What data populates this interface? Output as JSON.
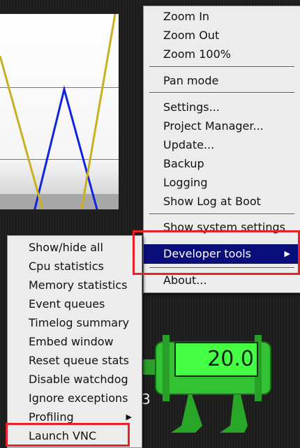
{
  "main_menu": {
    "items": [
      {
        "label": "Zoom In"
      },
      {
        "label": "Zoom Out"
      },
      {
        "label": "Zoom 100%"
      },
      {
        "label": "Pan mode"
      },
      {
        "label": "Settings..."
      },
      {
        "label": "Project Manager..."
      },
      {
        "label": "Update..."
      },
      {
        "label": "Backup"
      },
      {
        "label": "Logging"
      },
      {
        "label": "Show Log at Boot"
      },
      {
        "label": "Show system settings"
      },
      {
        "label": "Developer tools"
      },
      {
        "label": "About..."
      }
    ],
    "submenu_arrow": "▶"
  },
  "developer_submenu": {
    "items": [
      {
        "label": "Show/hide all"
      },
      {
        "label": "Cpu statistics"
      },
      {
        "label": "Memory statistics"
      },
      {
        "label": "Event queues"
      },
      {
        "label": "Timelog summary"
      },
      {
        "label": "Embed window"
      },
      {
        "label": "Reset queue stats"
      },
      {
        "label": "Disable watchdog"
      },
      {
        "label": "Ignore exceptions"
      },
      {
        "label": "Profiling"
      },
      {
        "label": "Launch VNC"
      }
    ],
    "submenu_arrow": "▶"
  },
  "pump_display": {
    "value": "20.0"
  },
  "background_text": "3",
  "colors": {
    "highlight_box": "#e8202a",
    "selected_item": "#0a0e7a",
    "trend_blue": "#1024e0",
    "trend_yellow": "#c8b020",
    "pump_green": "#2fbf2f"
  }
}
